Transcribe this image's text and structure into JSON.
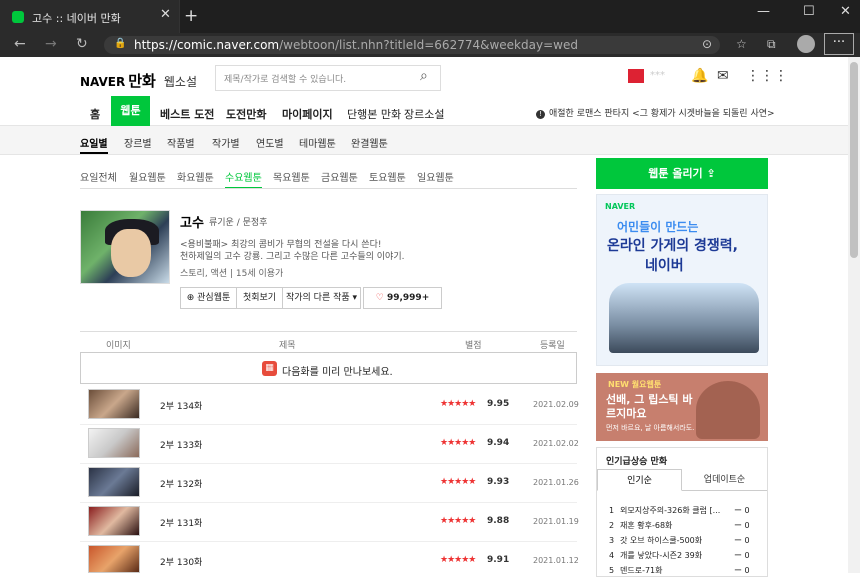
{
  "browser": {
    "tab_title": "고수 :: 네이버 만화",
    "tab_close": "✕",
    "new_tab": "+",
    "win_min": "—",
    "win_max": "☐",
    "win_close": "✕",
    "back": "←",
    "forward": "→",
    "reload": "↻",
    "url_prefix": "https://comic.naver.com",
    "url_path": "/webtoon/list.nhn?titleId=662774&weekday=wed",
    "more": "···"
  },
  "header": {
    "naver": "NAVER",
    "manhwa": "만화",
    "sub": "웹소설",
    "search_placeholder": "제목/작가로 검색할 수 있습니다.",
    "username": "***"
  },
  "main_nav": [
    "홈",
    "웹툰",
    "베스트 도전",
    "도전만화",
    "마이페이지",
    "단행본 만화",
    "장르소설"
  ],
  "notice": "애절한 로맨스 판타지 <그 황제가 시겟바늘을 되돌린 사연>",
  "sub_nav": [
    "요일별",
    "장르별",
    "작품별",
    "작가별",
    "연도별",
    "테마웹툰",
    "완결웹툰"
  ],
  "day_nav": [
    "요일전체",
    "월요웹툰",
    "화요웹툰",
    "수요웹툰",
    "목요웹툰",
    "금요웹툰",
    "토요웹툰",
    "일요웹툰"
  ],
  "comic": {
    "title": "고수",
    "author": "류기운 / 문정후",
    "desc1": "<용비불패> 최강의 콤비가 무협의 전설을 다시 쓴다!",
    "desc2": "천하제일의 고수 강룡. 그리고 수많은 다른 고수들의 이야기.",
    "genre": "스토리, 액션  |  15세 이용가",
    "btn_fav": "관심웹툰",
    "btn_first": "첫회보기",
    "btn_other": "작가의 다른 작품 ▾",
    "likes": "99,999+"
  },
  "list": {
    "headers": [
      "이미지",
      "제목",
      "별점",
      "등록일"
    ],
    "preview": "다음화를 미리 만나보세요.",
    "rows": [
      {
        "title": "2부 134화",
        "stars": "★★★★★",
        "score": "9.95",
        "date": "2021.02.09"
      },
      {
        "title": "2부 133화",
        "stars": "★★★★★",
        "score": "9.94",
        "date": "2021.02.02"
      },
      {
        "title": "2부 132화",
        "stars": "★★★★★",
        "score": "9.93",
        "date": "2021.01.26"
      },
      {
        "title": "2부 131화",
        "stars": "★★★★★",
        "score": "9.88",
        "date": "2021.01.19"
      },
      {
        "title": "2부 130화",
        "stars": "★★★★★",
        "score": "9.91",
        "date": "2021.01.12"
      }
    ]
  },
  "sidebar": {
    "upload": "웹툰 올리기 ⇪",
    "ad1_brand": "NAVER",
    "ad1_l1": "어민들이 만드는",
    "ad1_l2": "온라인 가게의 경쟁력,",
    "ad1_l3": "네이버",
    "ad2_tag": "NEW 월요웹툰",
    "ad2_title": "선배, 그 립스틱 바르지마요",
    "ad2_sub": "먼저 바르요, 날 아름해서라도.",
    "rank_title": "인기급상승 만화",
    "rank_tabs": [
      "인기순",
      "업데이트순"
    ],
    "rank_items": [
      {
        "n": "1",
        "t": "외모지상주의-326화 클럽 [..."
      },
      {
        "n": "2",
        "t": "재혼 황후-68화"
      },
      {
        "n": "3",
        "t": "갓 오브 하이스쿨-500화"
      },
      {
        "n": "4",
        "t": "개를 낳았다-시즌2 39화"
      },
      {
        "n": "5",
        "t": "덴드로-71화"
      }
    ],
    "rank_change": "ー   0"
  }
}
